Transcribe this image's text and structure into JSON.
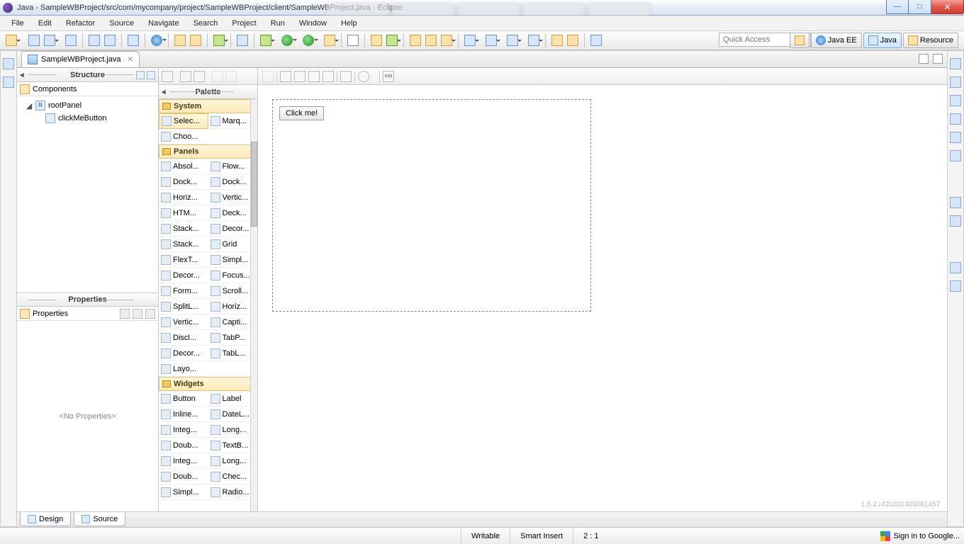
{
  "window": {
    "title": "Java - SampleWBProject/src/com/mycompany/project/SampleWBProject/client/SampleWBProject.java - Eclipse"
  },
  "winbtns": {
    "min": "—",
    "max": "□",
    "close": "✕"
  },
  "menu": [
    "File",
    "Edit",
    "Refactor",
    "Source",
    "Navigate",
    "Search",
    "Project",
    "Run",
    "Window",
    "Help"
  ],
  "quick_access_placeholder": "Quick Access",
  "perspectives": {
    "javaee": "Java EE",
    "java": "Java",
    "resource": "Resource"
  },
  "editor_tab": {
    "name": "SampleWBProject.java"
  },
  "structure": {
    "title": "Structure",
    "components_label": "Components",
    "root": "rootPanel",
    "child": "clickMeButton"
  },
  "properties": {
    "title": "Properties",
    "empty": "<No Properties>"
  },
  "palette": {
    "title": "Palette",
    "cat_system": "System",
    "system_items": [
      "Selec...",
      "Marq...",
      "Choo..."
    ],
    "cat_panels": "Panels",
    "panels_items": [
      "Absol...",
      "Flow...",
      "Dock...",
      "Dock...",
      "Horiz...",
      "Vertic...",
      "HTM...",
      "Deck...",
      "Stack...",
      "Decor...",
      "Stack...",
      "Grid",
      "FlexT...",
      "Simpl...",
      "Decor...",
      "Focus...",
      "Form...",
      "Scroll...",
      "SplitL...",
      "Horiz...",
      "Vertic...",
      "Capti...",
      "Discl...",
      "TabP...",
      "Decor...",
      "TabL...",
      "Layo..."
    ],
    "cat_widgets": "Widgets",
    "widgets_items": [
      "Button",
      "Label",
      "Inline...",
      "DateL...",
      "Integ...",
      "Long...",
      "Doub...",
      "TextB...",
      "Integ...",
      "Long...",
      "Doub...",
      "Chec...",
      "Simpl...",
      "Radio..."
    ]
  },
  "canvas": {
    "button_text": "Click me!",
    "build_id": "1.5.2.r42x201303061457"
  },
  "bottom_tabs": {
    "design": "Design",
    "source": "Source"
  },
  "status": {
    "writable": "Writable",
    "insert": "Smart Insert",
    "pos": "2 : 1",
    "signin": "Sign in to Google..."
  }
}
